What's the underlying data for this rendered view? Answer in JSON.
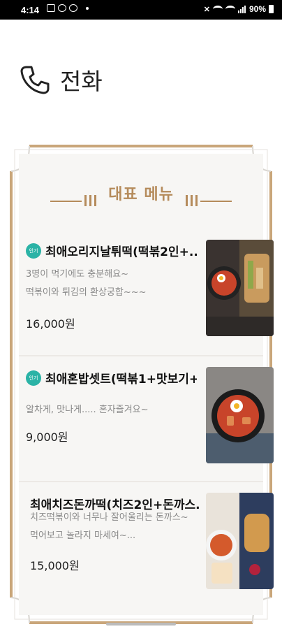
{
  "status": {
    "time": "4:14",
    "battery": "90%"
  },
  "header": {
    "title": "전화",
    "icon": "phone-icon"
  },
  "section": {
    "title": "대표 메뉴"
  },
  "menu": [
    {
      "name": "최애오리지날튀떡(떡볶2인+...",
      "badge": "인기",
      "desc1": "3명이 먹기에도 충분해요~",
      "desc2": "떡볶이와 튀김의 환상궁합~~~",
      "price": "16,000원"
    },
    {
      "name": "최애혼밥셋트(떡볶1+맛보기+...",
      "badge": "인기",
      "desc1": "알차게, 맛나게..... 혼자즐겨요~",
      "desc2": "",
      "price": "9,000원"
    },
    {
      "name": "최애치즈돈까떡(치즈2인+돈까스...",
      "badge": "",
      "desc1": "치즈떡볶이와 너무나 잘어울리는 돈까스~",
      "desc2": "먹어보고 놀라지 마세여~...",
      "price": "15,000원"
    }
  ],
  "colors": {
    "accent": "#b58b5b",
    "badge": "#2bb3a6"
  }
}
